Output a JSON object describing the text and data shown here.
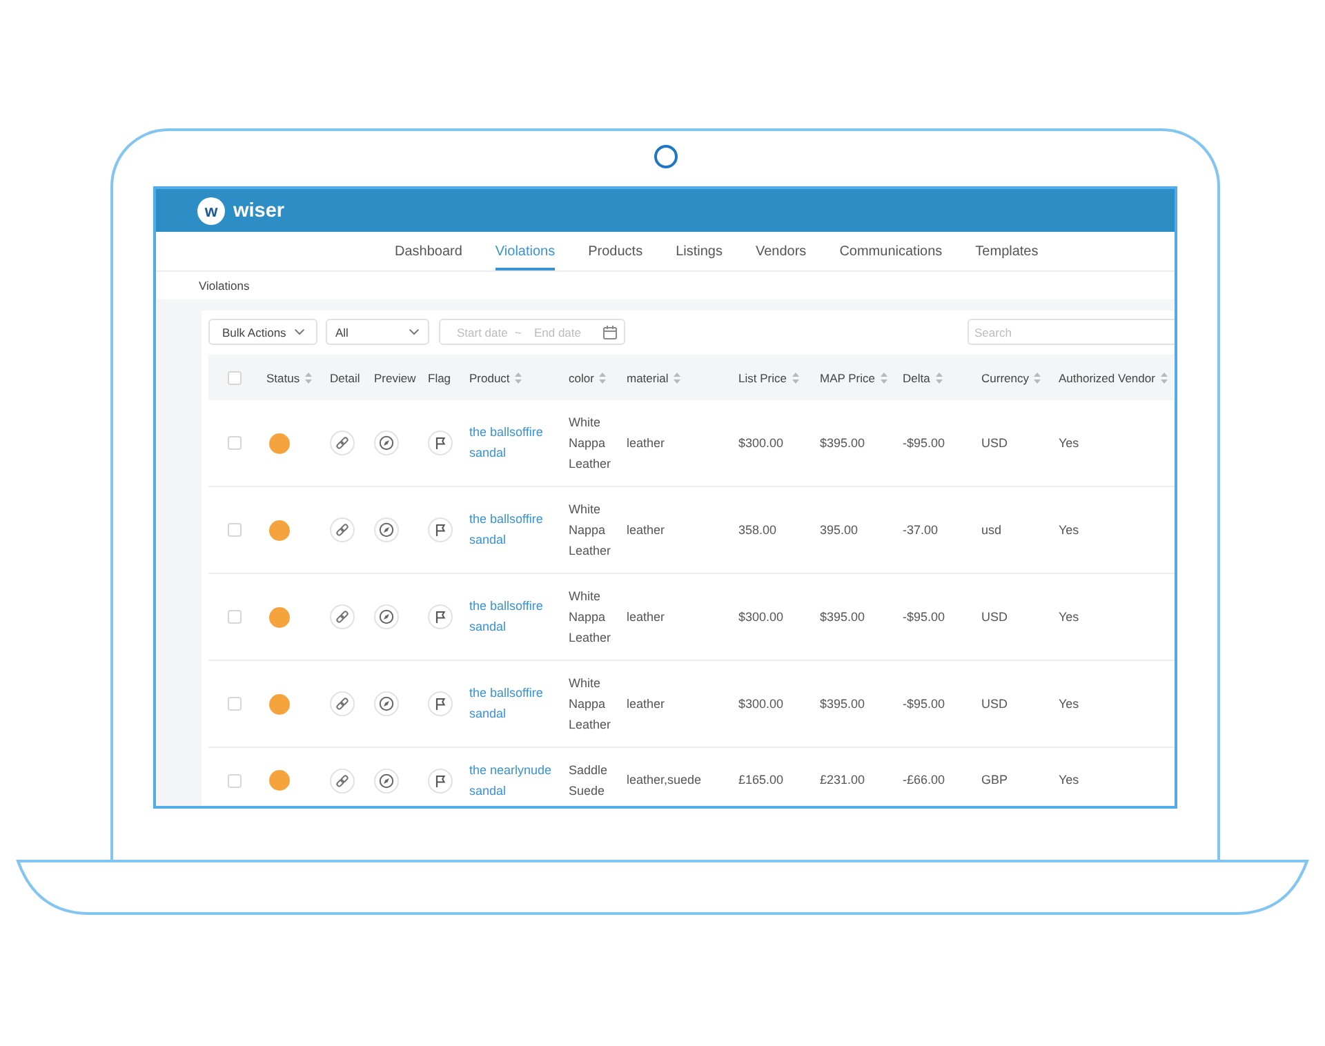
{
  "app": {
    "logo_mark": "w",
    "name": "wiser"
  },
  "nav": [
    {
      "label": "Dashboard",
      "selected": false
    },
    {
      "label": "Violations",
      "selected": true
    },
    {
      "label": "Products",
      "selected": false
    },
    {
      "label": "Listings",
      "selected": false
    },
    {
      "label": "Vendors",
      "selected": false
    },
    {
      "label": "Communications",
      "selected": false
    },
    {
      "label": "Templates",
      "selected": false
    }
  ],
  "breadcrumb": "Violations",
  "toolbar": {
    "bulk_actions": "Bulk Actions",
    "filter": {
      "value": "All"
    },
    "date_range": {
      "start": {
        "placeholder": "Start date"
      },
      "separator": "~",
      "end": {
        "placeholder": "End date"
      }
    },
    "search": {
      "placeholder": "Search"
    }
  },
  "table": {
    "select_all_checked": false,
    "columns": [
      {
        "label": "Status",
        "sortable": true
      },
      {
        "label": "Detail",
        "sortable": false
      },
      {
        "label": "Preview",
        "sortable": false
      },
      {
        "label": "Flag",
        "sortable": false
      },
      {
        "label": "Product",
        "sortable": true
      },
      {
        "label": "color",
        "sortable": true
      },
      {
        "label": "material",
        "sortable": true
      },
      {
        "label": "List Price",
        "sortable": true
      },
      {
        "label": "MAP Price",
        "sortable": true
      },
      {
        "label": "Delta",
        "sortable": true
      },
      {
        "label": "Currency",
        "sortable": true
      },
      {
        "label": "Authorized Vendor",
        "sortable": true
      }
    ],
    "rows": [
      {
        "checked": false,
        "color": "#f5a33d",
        "product": "the ballsoffire sandal",
        "product_color": "White Nappa Leather",
        "material": "leather",
        "list_price": "$300.00",
        "map_price": "$395.00",
        "delta": "-$95.00",
        "currency": "USD",
        "authorized_vendor": "Yes"
      },
      {
        "checked": false,
        "color": "#f5a33d",
        "product": "the ballsoffire sandal",
        "product_color": "White Nappa Leather",
        "material": "leather",
        "list_price": "358.00",
        "map_price": "395.00",
        "delta": "-37.00",
        "currency": "usd",
        "authorized_vendor": "Yes"
      },
      {
        "checked": false,
        "color": "#f5a33d",
        "product": "the ballsoffire sandal",
        "product_color": "White Nappa Leather",
        "material": "leather",
        "list_price": "$300.00",
        "map_price": "$395.00",
        "delta": "-$95.00",
        "currency": "USD",
        "authorized_vendor": "Yes"
      },
      {
        "checked": false,
        "color": "#f5a33d",
        "product": "the ballsoffire sandal",
        "product_color": "White Nappa Leather",
        "material": "leather",
        "list_price": "$300.00",
        "map_price": "$395.00",
        "delta": "-$95.00",
        "currency": "USD",
        "authorized_vendor": "Yes"
      },
      {
        "checked": false,
        "color": "#f5a33d",
        "product": "the nearlynude sandal",
        "product_color": "Saddle Suede",
        "material": "leather,suede",
        "list_price": "£165.00",
        "map_price": "£231.00",
        "delta": "-£66.00",
        "currency": "GBP",
        "authorized_vendor": "Yes"
      }
    ]
  }
}
